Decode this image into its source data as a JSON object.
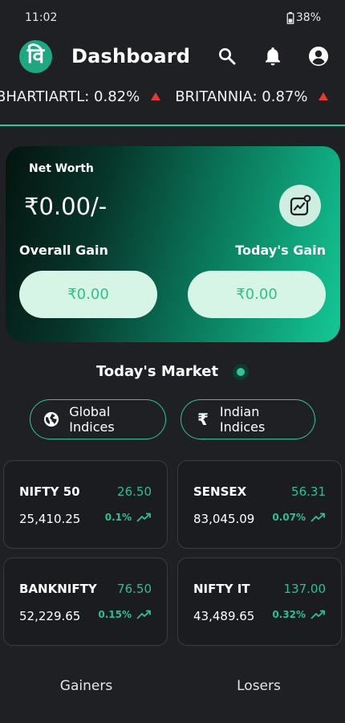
{
  "status": {
    "time": "11:02",
    "battery": "38%"
  },
  "header": {
    "logo_glyph": "वि",
    "title": "Dashboard"
  },
  "ticker": [
    {
      "text": "BHARTIARTL: 0.82%"
    },
    {
      "text": "BRITANNIA: 0.87%"
    }
  ],
  "net_worth": {
    "label": "Net Worth",
    "value": "₹0.00/-",
    "overall_label": "Overall Gain",
    "today_label": "Today's Gain",
    "overall_value": "₹0.00",
    "today_value": "₹0.00"
  },
  "market": {
    "title": "Today's Market",
    "global_button": "Global Indices",
    "indian_button": "Indian Indices",
    "rupee_glyph": "₹"
  },
  "indices": [
    {
      "name": "NIFTY 50",
      "change": "26.50",
      "price": "25,410.25",
      "pct": "0.1%"
    },
    {
      "name": "SENSEX",
      "change": "56.31",
      "price": "83,045.09",
      "pct": "0.07%"
    },
    {
      "name": "BANKNIFTY",
      "change": "76.50",
      "price": "52,229.65",
      "pct": "0.15%"
    },
    {
      "name": "NIFTY IT",
      "change": "137.00",
      "price": "43,489.65",
      "pct": "0.32%"
    }
  ],
  "tabs": {
    "gainers": "Gainers",
    "losers": "Losers"
  },
  "colors": {
    "accent": "#2fc49b",
    "up": "#2fbf92",
    "ticker_arrow": "#e53935",
    "background": "#1f2024"
  },
  "icons": [
    "battery-icon",
    "search-icon",
    "bell-icon",
    "account-icon",
    "chart-icon",
    "globe-icon",
    "trend-up-icon",
    "triangle-up-icon"
  ]
}
